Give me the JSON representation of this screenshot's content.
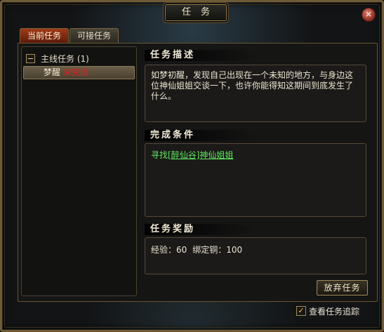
{
  "window": {
    "title": "任务",
    "close_symbol": "×"
  },
  "tabs": [
    {
      "label": "当前任务",
      "active": true
    },
    {
      "label": "可接任务",
      "active": false
    }
  ],
  "quest_list": {
    "group_label": "主线任务 (1)",
    "items": [
      {
        "name": "梦醒",
        "status": "未完成",
        "status_color": "#e02020",
        "selected": true
      }
    ]
  },
  "description": {
    "header": "任务描述",
    "text": "如梦初醒，发现自己出现在一个未知的地方，与身边这位神仙姐姐交谈一下，也许你能得知这期间到底发生了什么。"
  },
  "conditions": {
    "header": "完成条件",
    "prefix": "寻找",
    "link": "[醉仙谷]神仙姐姐",
    "color": "#5ee85e"
  },
  "rewards": {
    "header": "任务奖励",
    "exp_label": "经验：60",
    "copper_label": "绑定铜：100"
  },
  "abandon_button": "放弃任务",
  "track_checkbox": {
    "label": "查看任务追踪",
    "checked": true,
    "check_symbol": "✓"
  },
  "colors": {
    "accent_tab": "#a03a18",
    "frame_gold": "#6e5a36",
    "status_red": "#e02020",
    "link_green": "#5ee85e"
  }
}
